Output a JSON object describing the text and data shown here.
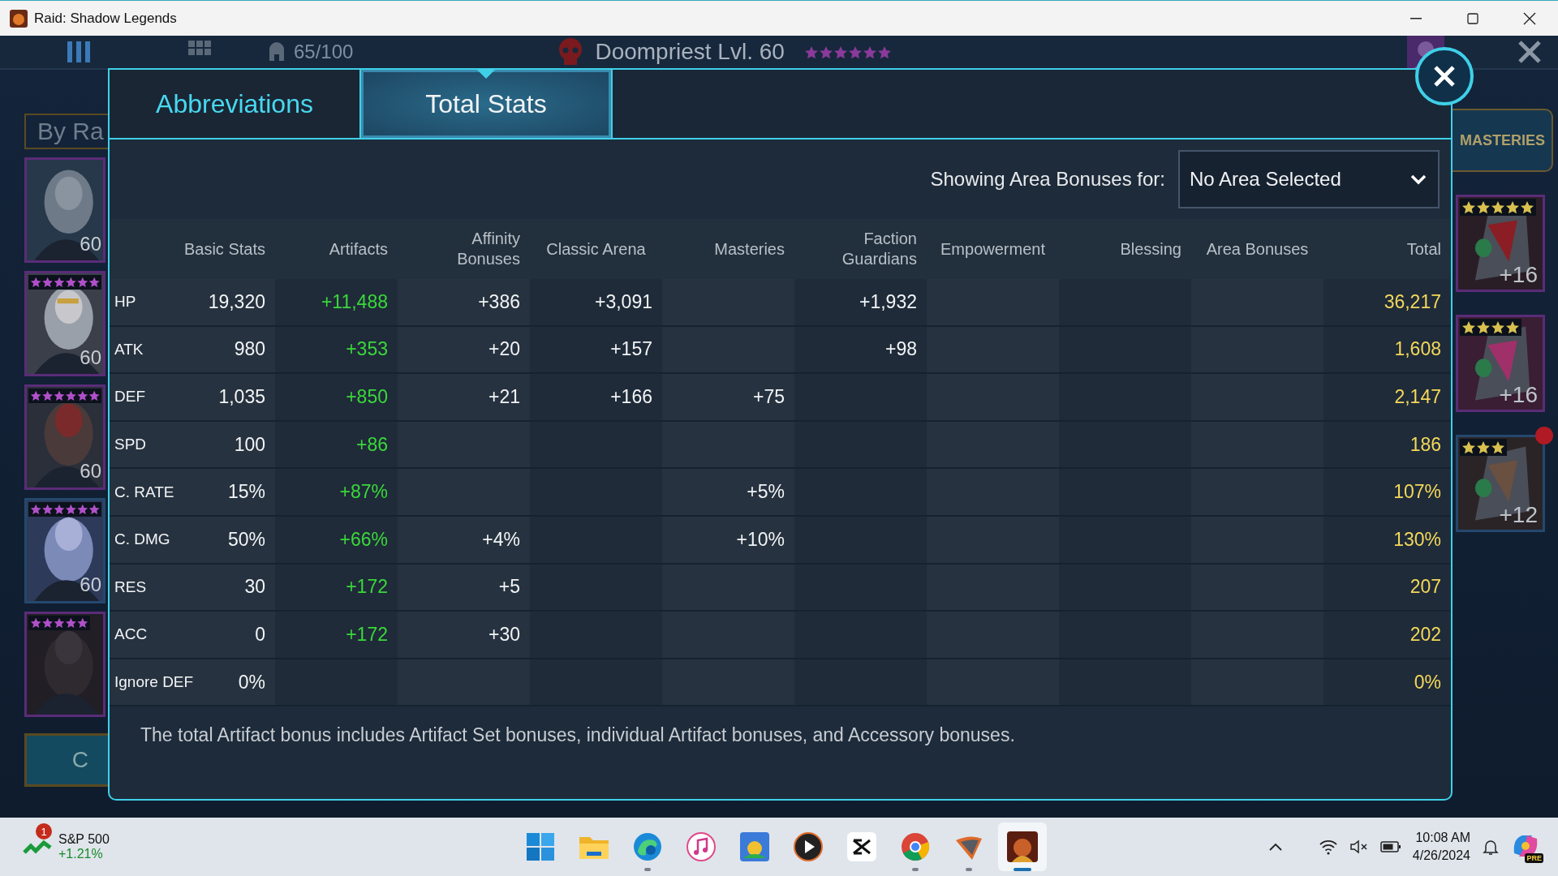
{
  "window": {
    "title": "Raid: Shadow Legends"
  },
  "game": {
    "capacity": "65/100",
    "hero": {
      "title": "Doompriest Lvl. 60",
      "stars": 6
    },
    "sort_label": "By Ra",
    "bottom_button": "C",
    "masteries_button": "MASTERIES",
    "heroes": [
      {
        "level": "60",
        "color": "#5a2c78"
      },
      {
        "level": "60",
        "color": "#5a2c78",
        "stars": 6
      },
      {
        "level": "60",
        "color": "#5a2c78",
        "stars": 6
      },
      {
        "level": "60",
        "color": "#24486e",
        "stars": 6
      },
      {
        "color": "#5a2c78",
        "stars": 5
      }
    ],
    "artifacts": [
      {
        "level": "+16",
        "color": "#5a2c78",
        "stars": 5,
        "alert": false
      },
      {
        "level": "+16",
        "color": "#5a2c78",
        "stars": 4,
        "alert": false
      },
      {
        "level": "+12",
        "color": "#24486e",
        "stars": 3,
        "alert": true
      }
    ]
  },
  "dialog": {
    "tabs": [
      {
        "label": "Abbreviations",
        "selected": false
      },
      {
        "label": "Total Stats",
        "selected": true
      }
    ],
    "area_label": "Showing Area Bonuses for:",
    "area_select": "No Area Selected",
    "columns": [
      {
        "label": "Basic Stats",
        "kind": "base"
      },
      {
        "label": "Artifacts",
        "kind": "artifact"
      },
      {
        "label": "Affinity Bonuses",
        "kind": "bonus"
      },
      {
        "label": "Classic Arena",
        "kind": "bonus"
      },
      {
        "label": "Masteries",
        "kind": "bonus"
      },
      {
        "label": "Faction Guardians",
        "kind": "bonus"
      },
      {
        "label": "Empowerment",
        "kind": "bonus"
      },
      {
        "label": "Blessing",
        "kind": "bonus"
      },
      {
        "label": "Area Bonuses",
        "kind": "bonus"
      },
      {
        "label": "Total",
        "kind": "total"
      }
    ],
    "rows": [
      {
        "stat": "HP",
        "cells": [
          "19,320",
          "+11,488",
          "+386",
          "+3,091",
          null,
          "+1,932",
          null,
          null,
          null,
          "36,217"
        ]
      },
      {
        "stat": "ATK",
        "cells": [
          "980",
          "+353",
          "+20",
          "+157",
          null,
          "+98",
          null,
          null,
          null,
          "1,608"
        ]
      },
      {
        "stat": "DEF",
        "cells": [
          "1,035",
          "+850",
          "+21",
          "+166",
          "+75",
          null,
          null,
          null,
          null,
          "2,147"
        ]
      },
      {
        "stat": "SPD",
        "cells": [
          "100",
          "+86",
          null,
          null,
          null,
          null,
          null,
          null,
          null,
          "186"
        ]
      },
      {
        "stat": "C. RATE",
        "cells": [
          "15%",
          "+87%",
          null,
          null,
          "+5%",
          null,
          null,
          null,
          null,
          "107%"
        ]
      },
      {
        "stat": "C. DMG",
        "cells": [
          "50%",
          "+66%",
          "+4%",
          null,
          "+10%",
          null,
          null,
          null,
          null,
          "130%"
        ]
      },
      {
        "stat": "RES",
        "cells": [
          "30",
          "+172",
          "+5",
          null,
          null,
          null,
          null,
          null,
          null,
          "207"
        ]
      },
      {
        "stat": "ACC",
        "cells": [
          "0",
          "+172",
          "+30",
          null,
          null,
          null,
          null,
          null,
          null,
          "202"
        ]
      },
      {
        "stat": "Ignore DEF",
        "cells": [
          "0%",
          null,
          null,
          null,
          null,
          null,
          null,
          null,
          null,
          "0%"
        ]
      }
    ],
    "note": "The total Artifact bonus includes Artifact Set bonuses, individual Artifact bonuses, and Accessory bonuses."
  },
  "taskbar": {
    "widget": {
      "title": "S&P 500",
      "change": "+1.21%",
      "badge": "1"
    },
    "apps": [
      {
        "kind": "start",
        "running": false,
        "selected": false
      },
      {
        "kind": "folder",
        "running": false,
        "selected": false
      },
      {
        "kind": "edge",
        "running": true,
        "selected": false
      },
      {
        "kind": "music",
        "running": false,
        "selected": false
      },
      {
        "kind": "game",
        "running": false,
        "selected": false
      },
      {
        "kind": "player",
        "running": false,
        "selected": false
      },
      {
        "kind": "editor",
        "running": false,
        "selected": false
      },
      {
        "kind": "chrome",
        "running": true,
        "selected": false
      },
      {
        "kind": "wing",
        "running": true,
        "selected": false
      },
      {
        "kind": "raid",
        "running": false,
        "selected": true
      }
    ],
    "time": "10:08 AM",
    "date": "4/26/2024",
    "copilot_badge": "PRE"
  }
}
